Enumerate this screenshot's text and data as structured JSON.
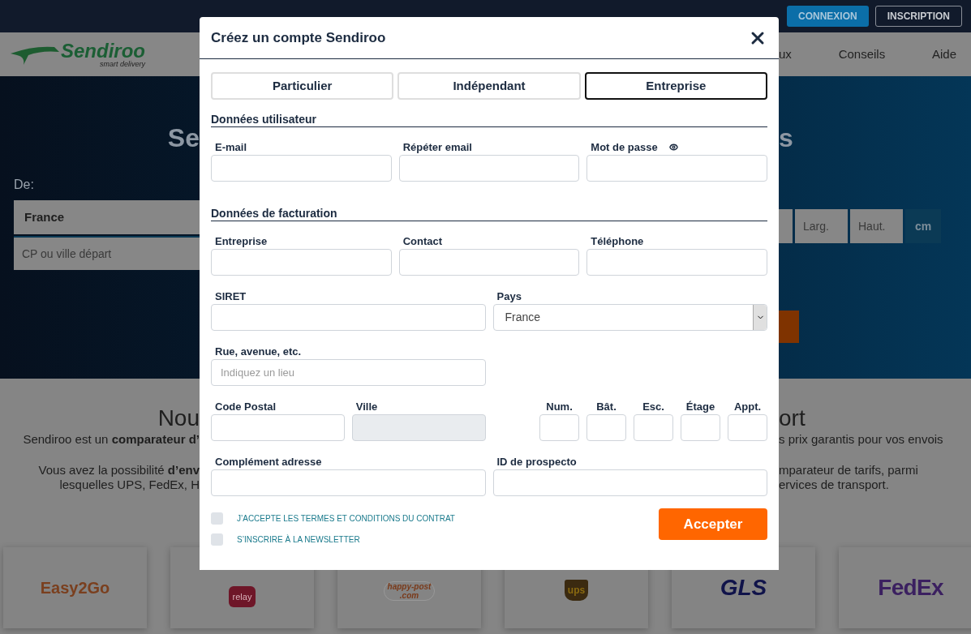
{
  "top_bar": {
    "buttons": [
      {
        "label": "CONNEXION",
        "kind": "primary"
      },
      {
        "label": "INSCRIPTION",
        "kind": "outline"
      }
    ]
  },
  "nav": {
    "logo": {
      "name": "Sendiroo",
      "tagline": "smart delivery"
    },
    "items": [
      "ux",
      "Conseils",
      "Aide"
    ]
  },
  "hero": {
    "heading_left": "Se",
    "heading_right": "s",
    "from_label": "De:",
    "country": "France",
    "city_placeholder": "CP ou ville départ",
    "dimension_fields": [
      "Larg.",
      "Haut."
    ],
    "unit": "cm"
  },
  "section": {
    "title_left": "Nou",
    "title_right": "ort",
    "paragraphs_left": [
      [
        "Sendiroo est un **comparateur d’**"
      ],
      [
        "Vous avez la possibilité **d’env**",
        "lesquelles UPS, FedEx, H"
      ]
    ],
    "paragraphs_right": [
      [
        "s prix garantis pour vos envois"
      ],
      [
        "mparateur de tarifs, parmi",
        "ervices de transport."
      ]
    ]
  },
  "partners": [
    {
      "kind": "easy2go",
      "text": "Easy2Go"
    },
    {
      "kind": "relay",
      "text": "relay"
    },
    {
      "kind": "happypost",
      "text": "happy-post",
      "sub": ".com"
    },
    {
      "kind": "ups",
      "text": "ups"
    },
    {
      "kind": "gls",
      "text": "GLS"
    },
    {
      "kind": "fedex",
      "text": "FedEx"
    }
  ],
  "modal": {
    "title": "Créez un compte Sendiroo",
    "tabs": [
      {
        "label": "Particulier",
        "selected": false
      },
      {
        "label": "Indépendant",
        "selected": false
      },
      {
        "label": "Entreprise",
        "selected": true
      }
    ],
    "user": {
      "title": "Données utilisateur",
      "fields": [
        {
          "label": "E-mail",
          "kind": "text"
        },
        {
          "label": "Répéter email",
          "kind": "text"
        },
        {
          "label": "Mot de passe",
          "kind": "password"
        }
      ]
    },
    "billing": {
      "title": "Données de facturation",
      "company": {
        "label": "Entreprise"
      },
      "contact": {
        "label": "Contact"
      },
      "phone": {
        "label": "Téléphone"
      },
      "siret": {
        "label": "SIRET"
      },
      "country": {
        "label": "Pays",
        "value": "France"
      },
      "street": {
        "label": "Rue, avenue, etc.",
        "placeholder": "Indiquez un lieu"
      },
      "postal_code": {
        "label": "Code Postal"
      },
      "city": {
        "label": "Ville",
        "disabled": true
      },
      "address_parts": [
        {
          "label": "Num."
        },
        {
          "label": "Bât."
        },
        {
          "label": "Esc."
        },
        {
          "label": "Étage"
        },
        {
          "label": "Appt."
        }
      ],
      "address_extra": {
        "label": "Complément adresse"
      },
      "prospect_id": {
        "label": "ID de prospecto"
      }
    },
    "checkboxes": [
      {
        "label": "J’ACCEPTE LES TERMES ET CONDITIONS DU CONTRAT",
        "checked": false
      },
      {
        "label": "S’INSCRIRE À LA NEWSLETTER",
        "checked": false
      }
    ],
    "submit": "Accepter"
  }
}
